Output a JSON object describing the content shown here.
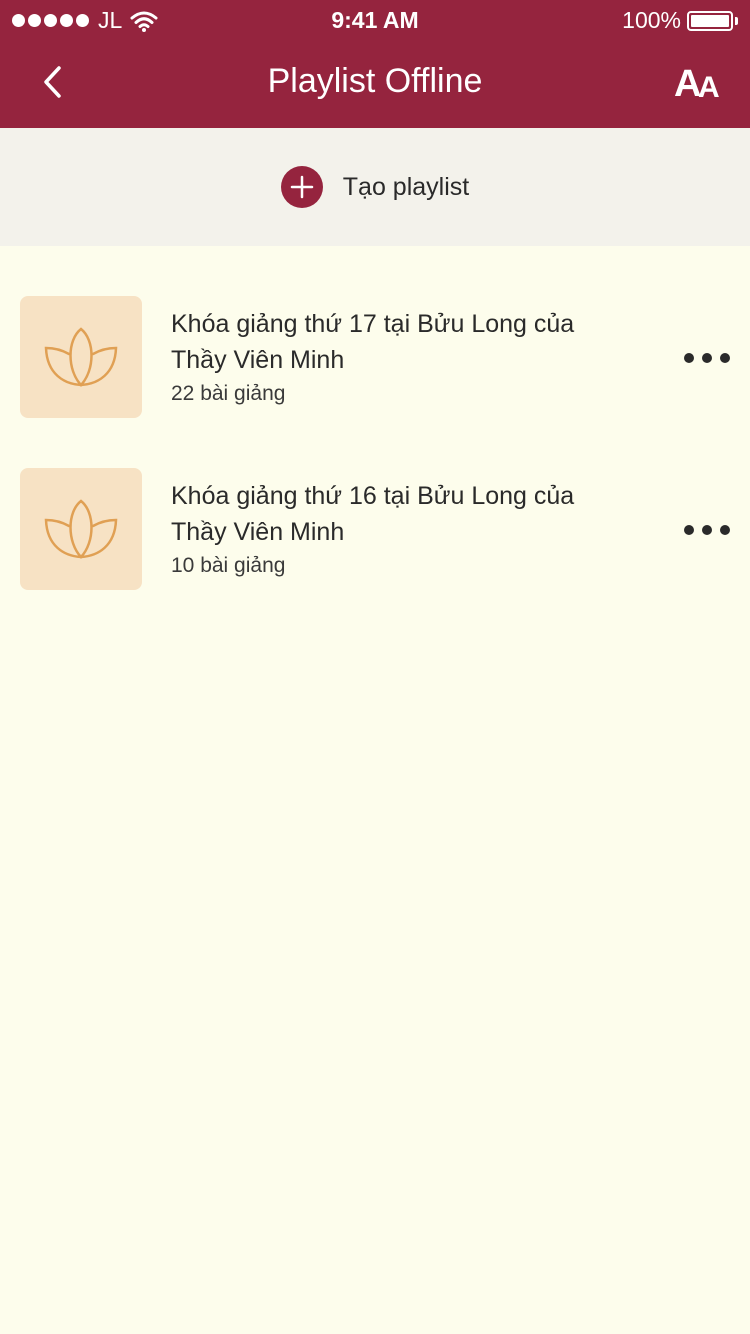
{
  "status_bar": {
    "carrier": "JL",
    "time": "9:41 AM",
    "battery": "100%"
  },
  "header": {
    "title": "Playlist Offline",
    "font_size_icon_big": "A",
    "font_size_icon_small": "A"
  },
  "create": {
    "label": "Tạo playlist"
  },
  "playlists": [
    {
      "title": "Khóa giảng thứ 17 tại Bửu Long của Thầy Viên Minh",
      "count": "22 bài giảng"
    },
    {
      "title": "Khóa giảng thứ 16 tại Bửu Long của Thầy Viên Minh",
      "count": "10 bài giảng"
    }
  ],
  "colors": {
    "brand": "#95243e",
    "background": "#fdfdec",
    "thumb_bg": "#f7e2c4",
    "lotus": "#e0a054"
  },
  "icons": [
    "back-chevron-icon",
    "font-size-icon",
    "plus-icon",
    "lotus-icon",
    "more-icon"
  ]
}
